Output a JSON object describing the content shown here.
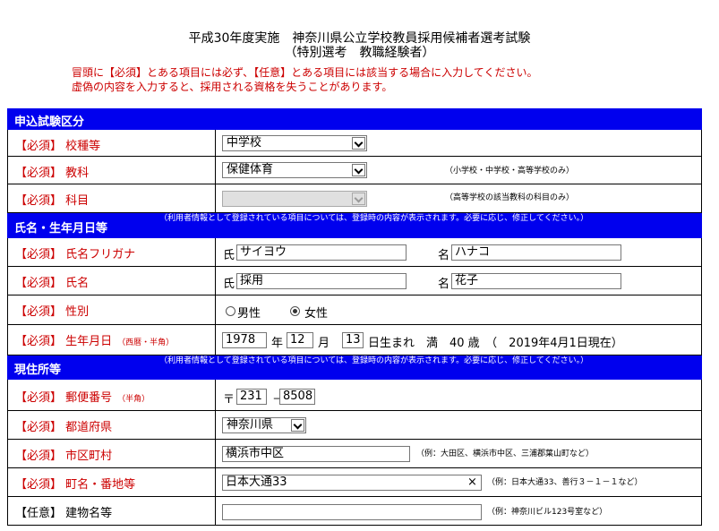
{
  "header": {
    "line1": "平成30年度実施　神奈川県公立学校教員採用候補者選考試験",
    "line2": "（特別選考　教職経験者）"
  },
  "notes": {
    "line1": "冒頭に【必須】とある項目には必ず、【任意】とある項目には該当する場合に入力してください。",
    "line2": "虚偽の内容を入力すると、採用される資格を失うことがあります。"
  },
  "sections": {
    "exam": {
      "title": "申込試験区分"
    },
    "name": {
      "title": "氏名・生年月日等",
      "note": "（利用者情報として登録されている項目については、登録時の内容が表示されます。必要に応じ、修正してください。）"
    },
    "address": {
      "title": "現住所等",
      "note": "（利用者情報として登録されている項目については、登録時の内容が表示されます。必要に応じ、修正してください。）"
    }
  },
  "fields": {
    "school_type": {
      "label": "【必須】 校種等",
      "value": "中学校"
    },
    "subject_area": {
      "label": "【必須】 教科",
      "value": "保健体育",
      "hint": "（小学校・中学校・高等学校のみ）"
    },
    "subject": {
      "label": "【必須】 科目",
      "value": "",
      "hint": "（高等学校の該当教科の科目のみ）"
    },
    "furigana": {
      "label": "【必須】 氏名フリガナ",
      "sei_label": "氏",
      "sei": "サイヨウ",
      "mei_label": "名",
      "mei": "ハナコ"
    },
    "name": {
      "label": "【必須】 氏名",
      "sei_label": "氏",
      "sei": "採用",
      "mei_label": "名",
      "mei": "花子"
    },
    "gender": {
      "label": "【必須】 性別",
      "male": "男性",
      "female": "女性",
      "selected": "female"
    },
    "birth": {
      "label": "【必須】 生年月日",
      "note": "（西暦・半角）",
      "year": "1978",
      "year_unit": "年",
      "month": "12",
      "month_unit": "月",
      "day": "13",
      "day_suffix": "日生まれ　満　40 歳　（　2019年4月1日現在）"
    },
    "postal": {
      "label": "【必須】 郵便番号",
      "note": "（半角）",
      "mark": "〒",
      "first": "231",
      "dash": "－",
      "second": "8508"
    },
    "prefecture": {
      "label": "【必須】 都道府県",
      "value": "神奈川県"
    },
    "city": {
      "label": "【必須】 市区町村",
      "value": "横浜市中区",
      "hint": "（例：大田区、横浜市中区、三浦郡葉山町など）"
    },
    "street": {
      "label": "【必須】 町名・番地等",
      "value": "日本大通33",
      "clear": "×",
      "hint": "（例：日本大通33、善行３－１－１など）"
    },
    "building": {
      "label": "【任意】 建物名等",
      "value": "",
      "hint": "（例：神奈川ビル123号室など）"
    }
  },
  "colors": {
    "section_bg": "#0000ee",
    "required": "#cc0000"
  }
}
